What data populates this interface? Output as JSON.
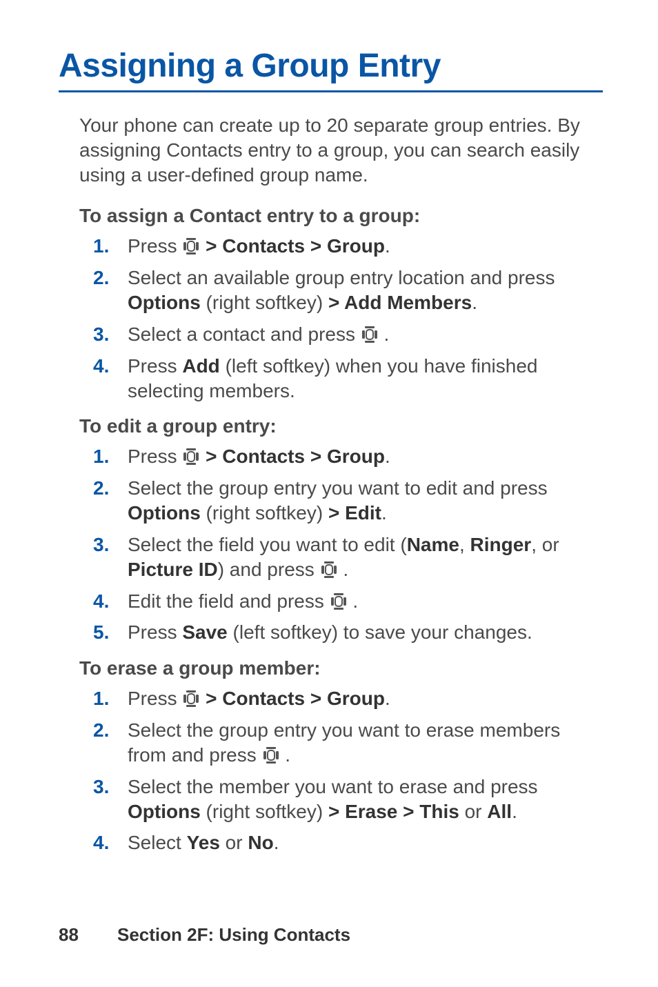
{
  "title": "Assigning a Group Entry",
  "intro": "Your phone can create up to 20 separate group entries. By assigning Contacts entry to a group, you can search easily using a user-defined group name.",
  "section_a": {
    "heading": "To assign a Contact entry to a group:",
    "steps": {
      "s1": {
        "a": "Press ",
        "b": " > Contacts > Group",
        "c": "."
      },
      "s2": {
        "a": "Select an available group entry location and press ",
        "b": "Options",
        "c": " (right softkey) ",
        "d": "> Add Members",
        "e": "."
      },
      "s3": {
        "a": "Select a contact and press ",
        "b": " ."
      },
      "s4": {
        "a": "Press ",
        "b": "Add",
        "c": " (left softkey) when you have finished selecting members."
      }
    }
  },
  "section_b": {
    "heading": "To edit a group entry:",
    "steps": {
      "s1": {
        "a": "Press ",
        "b": " > Contacts > Group",
        "c": "."
      },
      "s2": {
        "a": "Select the group entry you want to edit and press ",
        "b": "Options",
        "c": " (right softkey) ",
        "d": "> Edit",
        "e": "."
      },
      "s3": {
        "a": "Select the field you want to edit (",
        "b": "Name",
        "c": ", ",
        "d": "Ringer",
        "e": ", or ",
        "f": "Picture ID",
        "g": ") and press ",
        "h": " ."
      },
      "s4": {
        "a": "Edit the field and press ",
        "b": " ."
      },
      "s5": {
        "a": "Press ",
        "b": "Save",
        "c": " (left softkey) to save your changes."
      }
    }
  },
  "section_c": {
    "heading": "To erase a group member:",
    "steps": {
      "s1": {
        "a": "Press ",
        "b": " > Contacts > Group",
        "c": "."
      },
      "s2": {
        "a": "Select the group entry you want to erase members from and press ",
        "b": " ."
      },
      "s3": {
        "a": "Select the member you want to erase and press ",
        "b": "Options",
        "c": " (right softkey) ",
        "d": "> Erase > This",
        "e": " or ",
        "f": "All",
        "g": "."
      },
      "s4": {
        "a": "Select ",
        "b": "Yes",
        "c": " or ",
        "d": "No",
        "e": "."
      }
    }
  },
  "footer": {
    "page_number": "88",
    "section_label": "Section 2F: Using Contacts"
  },
  "icons": {
    "nav_key": "nav-key-icon"
  }
}
